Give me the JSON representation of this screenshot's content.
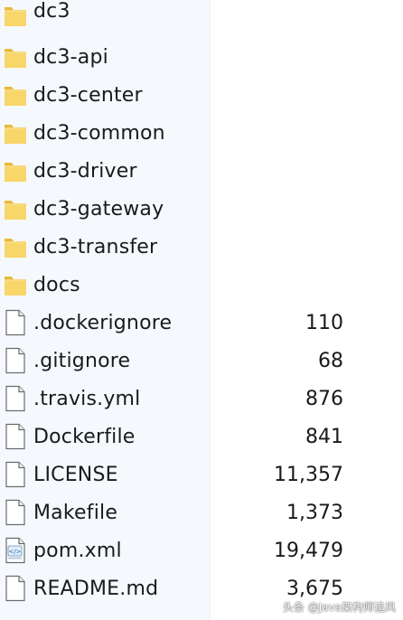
{
  "files": [
    {
      "name": "dc3",
      "type": "folder",
      "size": ""
    },
    {
      "name": "dc3-api",
      "type": "folder",
      "size": ""
    },
    {
      "name": "dc3-center",
      "type": "folder",
      "size": ""
    },
    {
      "name": "dc3-common",
      "type": "folder",
      "size": ""
    },
    {
      "name": "dc3-driver",
      "type": "folder",
      "size": ""
    },
    {
      "name": "dc3-gateway",
      "type": "folder",
      "size": ""
    },
    {
      "name": "dc3-transfer",
      "type": "folder",
      "size": ""
    },
    {
      "name": "docs",
      "type": "folder",
      "size": ""
    },
    {
      "name": ".dockerignore",
      "type": "file",
      "size": "110"
    },
    {
      "name": ".gitignore",
      "type": "file",
      "size": "68"
    },
    {
      "name": ".travis.yml",
      "type": "file",
      "size": "876"
    },
    {
      "name": "Dockerfile",
      "type": "file",
      "size": "841"
    },
    {
      "name": "LICENSE",
      "type": "file",
      "size": "11,357"
    },
    {
      "name": "Makefile",
      "type": "file",
      "size": "1,373"
    },
    {
      "name": "pom.xml",
      "type": "xml",
      "size": "19,479"
    },
    {
      "name": "README.md",
      "type": "file",
      "size": "3,675"
    }
  ],
  "watermark": "头条 @Java架构师追风",
  "colors": {
    "folder": "#f8d66a",
    "folder_dark": "#e9b93c",
    "name_column_bg": "#f5f9fd",
    "text": "#1a1a1a"
  },
  "icons": {
    "folder": "folder-icon",
    "file": "file-icon",
    "xml": "xml-file-icon"
  }
}
